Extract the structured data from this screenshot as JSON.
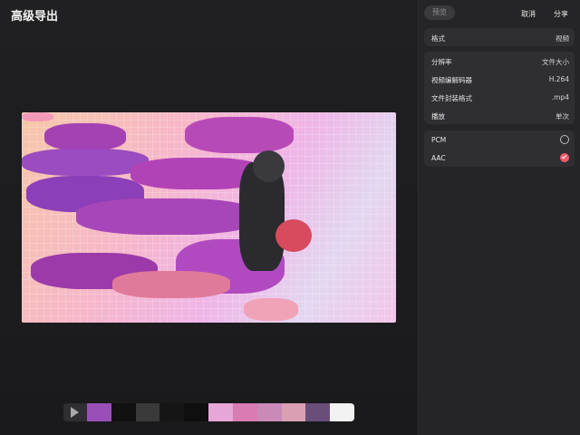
{
  "header": {
    "title": "高级导出"
  },
  "toolbar": {
    "preview_label": "预览",
    "cancel_label": "取消",
    "share_label": "分享"
  },
  "format": {
    "label": "格式",
    "value": "视频"
  },
  "settings": {
    "resolution": {
      "label": "分辨率",
      "value": "文件大小"
    },
    "codec": {
      "label": "视频编解码器",
      "value": "H.264"
    },
    "container": {
      "label": "文件封装格式",
      "value": ".mp4"
    },
    "playback": {
      "label": "播放",
      "value": "单次"
    }
  },
  "audio": {
    "options": [
      {
        "label": "PCM",
        "selected": false
      },
      {
        "label": "AAC",
        "selected": true
      }
    ]
  },
  "colors": {
    "accent": "#f05a6a",
    "panel": "#2f2f32",
    "background": "#1b1b1d"
  }
}
